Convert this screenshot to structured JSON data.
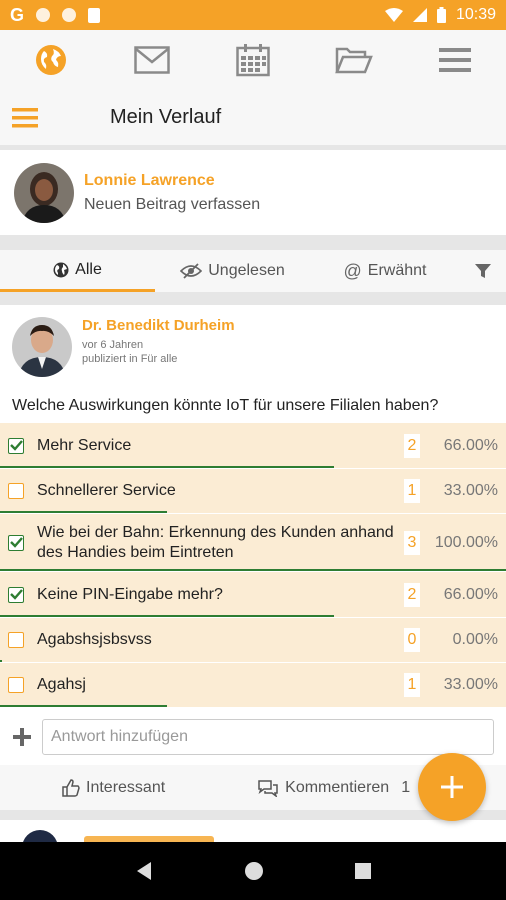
{
  "status_bar": {
    "time": "10:39"
  },
  "colors": {
    "accent": "#f5a227",
    "green": "#2e7d32",
    "option_bg": "#fbecd4"
  },
  "top_nav": {
    "icons": [
      "globe-icon",
      "mail-icon",
      "calendar-icon",
      "folder-icon",
      "menu-icon"
    ]
  },
  "header": {
    "title": "Mein Verlauf"
  },
  "composer": {
    "user_name": "Lonnie Lawrence",
    "hint": "Neuen Beitrag verfassen"
  },
  "tabs": [
    {
      "label": "Alle",
      "icon": "globe-icon",
      "active": true
    },
    {
      "label": "Ungelesen",
      "icon": "eye-slash-icon",
      "active": false
    },
    {
      "label": "Erwähnt",
      "icon": "at-icon",
      "active": false
    }
  ],
  "post": {
    "author": "Dr. Benedikt Durheim",
    "time": "vor 6 Jahren",
    "visibility": "publiziert in Für alle",
    "question": "Welche Auswirkungen könnte IoT für unsere Filialen haben?",
    "options": [
      {
        "label": "Mehr Service",
        "count": "2",
        "percent": "66.00%",
        "checked": true,
        "ratio": 0.66
      },
      {
        "label": "Schnellerer Service",
        "count": "1",
        "percent": "33.00%",
        "checked": false,
        "ratio": 0.33
      },
      {
        "label": "Wie bei der Bahn: Erkennung des Kunden anhand des Handies beim Eintreten",
        "count": "3",
        "percent": "100.00%",
        "checked": true,
        "ratio": 1.0
      },
      {
        "label": "Keine PIN-Eingabe mehr?",
        "count": "2",
        "percent": "66.00%",
        "checked": true,
        "ratio": 0.66
      },
      {
        "label": "Agabshsjsbsvss",
        "count": "0",
        "percent": "0.00%",
        "checked": false,
        "ratio": 0.0
      },
      {
        "label": "Agahsj",
        "count": "1",
        "percent": "33.00%",
        "checked": false,
        "ratio": 0.33
      }
    ],
    "answer_placeholder": "Antwort hinzufügen",
    "actions": {
      "like": "Interessant",
      "comment": "Kommentieren",
      "comment_count": "1"
    }
  }
}
